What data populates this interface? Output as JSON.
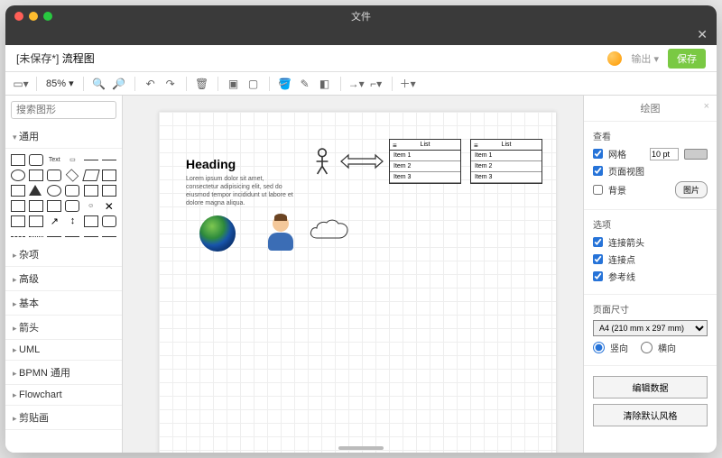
{
  "titlebar": {
    "title": "文件"
  },
  "header": {
    "unsaved": "[未保存*]",
    "doc_title": "流程图",
    "export": "输出 ▾",
    "save": "保存"
  },
  "toolbar": {
    "zoom": "85% ▾"
  },
  "sidebar": {
    "search_placeholder": "搜索图形",
    "general": "通用",
    "text_label": "Text",
    "categories": [
      "杂项",
      "高级",
      "基本",
      "箭头",
      "UML",
      "BPMN 通用",
      "Flowchart",
      "剪贴画"
    ]
  },
  "canvas": {
    "heading": "Heading",
    "lorem": "Lorem ipsum dolor sit amet, consectetur adipisicing elit, sed do eiusmod tempor incididunt ut labore et dolore magna aliqua.",
    "list_header": "List",
    "items": [
      "Item 1",
      "Item 2",
      "Item 3"
    ]
  },
  "right": {
    "title": "绘图",
    "view": "查看",
    "grid": "网格",
    "grid_val": "10 pt",
    "page_view": "页面视图",
    "background": "背景",
    "image_btn": "图片",
    "options": "选项",
    "conn_arrow": "连接箭头",
    "conn_point": "连接点",
    "guide": "参考线",
    "page_size": "页面尺寸",
    "page_option": "A4 (210 mm x 297 mm)",
    "portrait": "竖向",
    "landscape": "横向",
    "edit_data": "编辑数据",
    "reset_style": "清除默认风格"
  }
}
